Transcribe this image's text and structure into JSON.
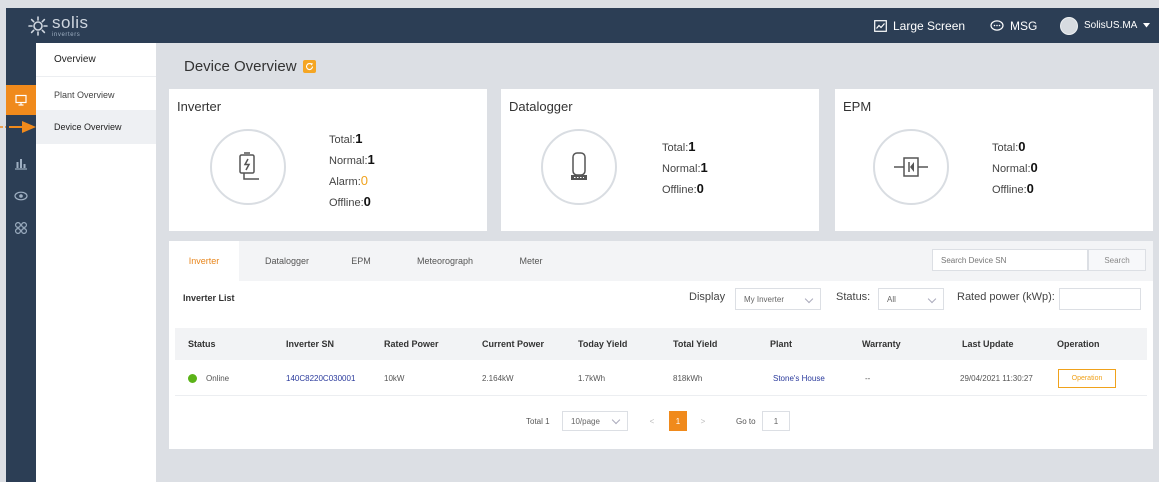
{
  "app": {
    "logo_name": "solis",
    "logo_sub": "inverters"
  },
  "topbar": {
    "large_screen": "Large Screen",
    "msg": "MSG",
    "user": "SolisUS.MA"
  },
  "subnav": {
    "items": [
      {
        "label": "Overview"
      },
      {
        "label": "Plant Overview"
      },
      {
        "label": "Device Overview"
      }
    ]
  },
  "page": {
    "title": "Device Overview"
  },
  "cards": {
    "inverter": {
      "title": "Inverter",
      "total_label": "Total:",
      "total": "1",
      "normal_label": "Normal:",
      "normal": "1",
      "alarm_label": "Alarm:",
      "alarm": "0",
      "offline_label": "Offline:",
      "offline": "0"
    },
    "datalogger": {
      "title": "Datalogger",
      "total_label": "Total:",
      "total": "1",
      "normal_label": "Normal:",
      "normal": "1",
      "offline_label": "Offline:",
      "offline": "0"
    },
    "epm": {
      "title": "EPM",
      "total_label": "Total:",
      "total": "0",
      "normal_label": "Normal:",
      "normal": "0",
      "offline_label": "Offline:",
      "offline": "0"
    }
  },
  "tabs": [
    {
      "label": "Inverter"
    },
    {
      "label": "Datalogger"
    },
    {
      "label": "EPM"
    },
    {
      "label": "Meteorograph"
    },
    {
      "label": "Meter"
    }
  ],
  "search": {
    "placeholder": "Search Device SN",
    "button": "Search"
  },
  "list": {
    "title": "Inverter List",
    "display_label": "Display",
    "display_value": "My Inverter",
    "status_label": "Status:",
    "status_value": "All",
    "rated_label": "Rated power (kWp):"
  },
  "table": {
    "headers": [
      "Status",
      "Inverter SN",
      "Rated Power",
      "Current Power",
      "Today Yield",
      "Total Yield",
      "Plant",
      "Warranty",
      "Last Update",
      "Operation"
    ],
    "rows": [
      {
        "status": "Online",
        "sn": "140C8220C030001",
        "rated": "10kW",
        "current": "2.164kW",
        "today": "1.7kWh",
        "total": "818kWh",
        "plant": "Stone's House",
        "warranty": "--",
        "updated": "29/04/2021 11:30:27",
        "operation": "Operation"
      }
    ]
  },
  "pagination": {
    "total_label": "Total 1",
    "page_size": "10/page",
    "prev": "<",
    "current": "1",
    "next": ">",
    "goto_label": "Go to",
    "goto_value": "1"
  },
  "colors": {
    "topbar": "#2c3e55",
    "accent": "#f08a1c",
    "online": "#5bb318",
    "link": "#2a3a9c"
  }
}
